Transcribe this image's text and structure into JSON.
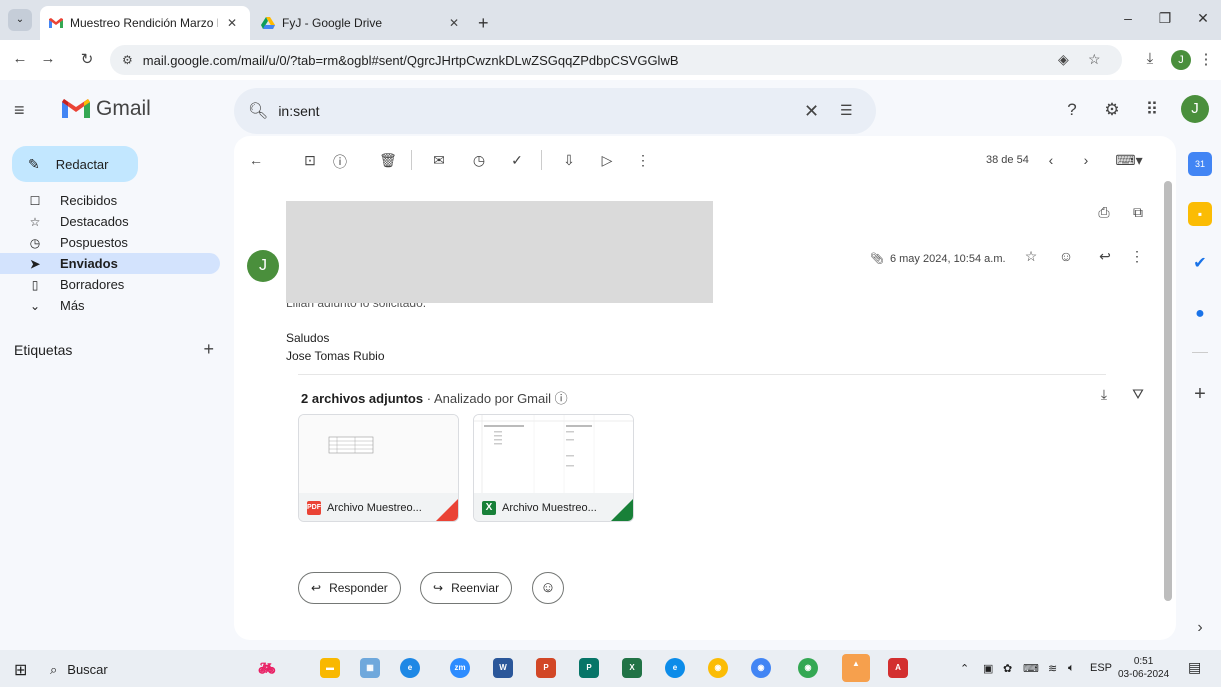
{
  "browser": {
    "tabs": [
      {
        "title": "Muestreo Rendición Marzo Feri",
        "active": true,
        "icon": "gmail-favicon"
      },
      {
        "title": "FyJ - Google Drive",
        "active": false,
        "icon": "drive-favicon"
      }
    ],
    "url": "mail.google.com/mail/u/0/?tab=rm&ogbl#sent/QgrcJHrtpCwznkDLwZSGqqZPdbpCSVGGlwB",
    "profile_initial": "J"
  },
  "gmail": {
    "brand": "Gmail",
    "search_query": "in:sent",
    "avatar_initial": "J",
    "compose_label": "Redactar",
    "nav": [
      {
        "label": "Recibidos",
        "icon": "inbox-icon",
        "active": false
      },
      {
        "label": "Destacados",
        "icon": "star-icon",
        "active": false
      },
      {
        "label": "Pospuestos",
        "icon": "clock-icon",
        "active": false
      },
      {
        "label": "Enviados",
        "icon": "send-icon",
        "active": true
      },
      {
        "label": "Borradores",
        "icon": "draft-icon",
        "active": false
      },
      {
        "label": "Más",
        "icon": "chevron-down-icon",
        "active": false
      }
    ],
    "labels_heading": "Etiquetas",
    "pager": "38 de 54",
    "message": {
      "sender_initial": "J",
      "date": "6 may 2024, 10:54 a.m.",
      "body_cut_line": "Lilian adjunto lo solicitado.",
      "greeting": "Saludos",
      "signature": "Jose Tomas Rubio"
    },
    "attachments": {
      "count_label": "2 archivos adjuntos",
      "scanned_label": "Analizado por Gmail",
      "items": [
        {
          "name": "Archivo Muestreo...",
          "type": "PDF",
          "color": "#ea4335"
        },
        {
          "name": "Archivo Muestreo...",
          "type": "X",
          "color": "#188038"
        }
      ]
    },
    "actions": {
      "reply": "Responder",
      "forward": "Reenviar"
    }
  },
  "taskbar": {
    "search_label": "Buscar",
    "language": "ESP",
    "time": "0:51",
    "date": "03-06-2024"
  }
}
